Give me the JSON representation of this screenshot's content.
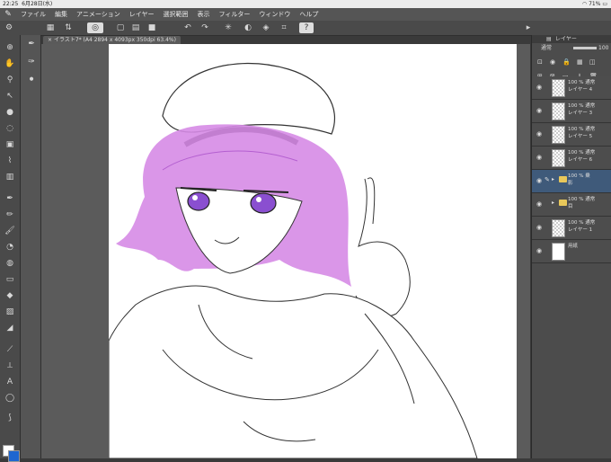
{
  "status": {
    "time": "22:25",
    "date": "6月28日(水)",
    "battery": "71%"
  },
  "menu": [
    "ファイル",
    "編集",
    "アニメーション",
    "レイヤー",
    "選択範囲",
    "表示",
    "フィルター",
    "ウィンドウ",
    "ヘルプ"
  ],
  "tab": {
    "title": "イラスト7* (A4 2894 x 4093px 350dpi 63.4%)"
  },
  "layers_panel": {
    "tab_label": "レイヤー",
    "blend_mode": "通常",
    "opacity": "100",
    "layers": [
      {
        "pct": "100 % 通常",
        "name": "レイヤー 4",
        "kind": "raster"
      },
      {
        "pct": "100 % 通常",
        "name": "レイヤー 3",
        "kind": "raster"
      },
      {
        "pct": "100 % 通常",
        "name": "レイヤー 5",
        "kind": "raster"
      },
      {
        "pct": "100 % 通常",
        "name": "レイヤー 6",
        "kind": "raster"
      },
      {
        "pct": "100 % 乗",
        "name": "影",
        "kind": "folder"
      },
      {
        "pct": "100 % 通常",
        "name": "目",
        "kind": "folder"
      },
      {
        "pct": "100 % 通常",
        "name": "レイヤー 1",
        "kind": "raster"
      },
      {
        "pct": "",
        "name": "用紙",
        "kind": "paper"
      }
    ]
  },
  "colors": {
    "main": "#ffffff",
    "sub": "#1e66d0",
    "hair": "#d68be6",
    "eyes": "#8a4fd0"
  }
}
